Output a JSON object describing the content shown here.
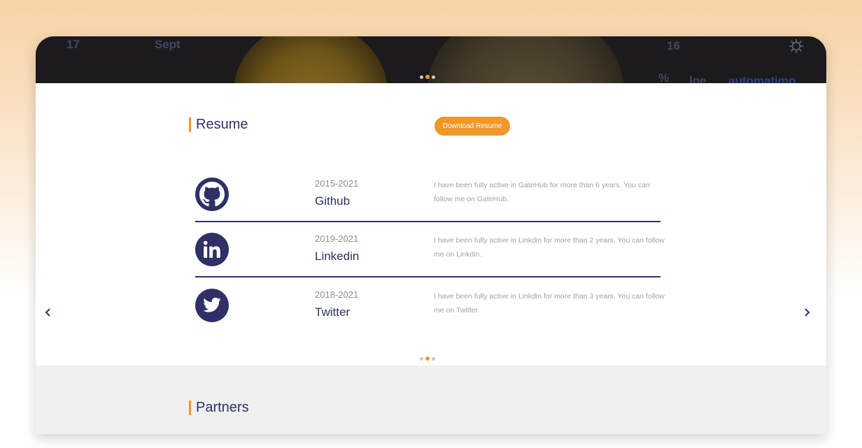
{
  "hero": {
    "texts": [
      "17",
      "Sept",
      "16",
      "%",
      "loe",
      "automatimo"
    ],
    "active_slide": 2,
    "slide_count": 3
  },
  "resume": {
    "title": "Resume",
    "download_label": "Download Resume",
    "items": [
      {
        "icon": "github-icon",
        "years": "2015-2021",
        "name": "Github",
        "description": "I have been fully active in GateHub for more than 6 years. You can follow me on GateHub."
      },
      {
        "icon": "linkedin-icon",
        "years": "2019-2021",
        "name": "Linkedin",
        "description": "I have been fully active in Linkdin for more than 2 years. You can follow me on Linkdin."
      },
      {
        "icon": "twitter-icon",
        "years": "2018-2021",
        "name": "Twitter",
        "description": "I have been fully active in Linkdin for more than 3 years. You can follow me on Twitter."
      }
    ],
    "active_slide": 2,
    "slide_count": 3
  },
  "partners": {
    "title": "Partners"
  },
  "colors": {
    "accent": "#f0972a",
    "navy": "#2e3066",
    "muted_text": "#a2a2aa",
    "partners_bg": "#f0f0f1"
  }
}
